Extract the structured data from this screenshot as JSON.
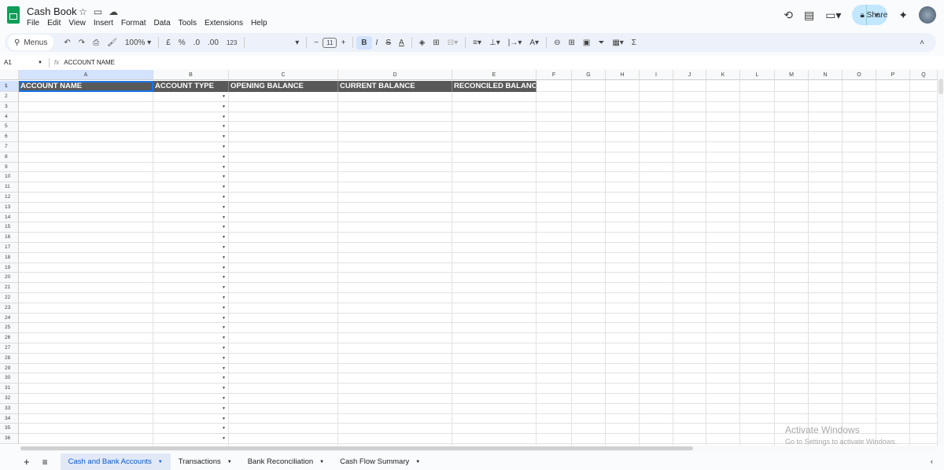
{
  "doc": {
    "title": "Cash Book"
  },
  "menu": [
    "File",
    "Edit",
    "View",
    "Insert",
    "Format",
    "Data",
    "Tools",
    "Extensions",
    "Help"
  ],
  "share": {
    "label": "Share"
  },
  "toolbar": {
    "search": "Menus",
    "zoom": "100%",
    "currency": "£",
    "percent": "%",
    "dec_dec": ".0",
    "inc_dec": ".00",
    "format_num": "123",
    "font_size": "11",
    "bold": "B",
    "italic": "I",
    "strike": "S",
    "text_color": "A",
    "sum": "Σ"
  },
  "formula_bar": {
    "cell": "A1",
    "fx": "fx",
    "content": "ACCOUNT NAME"
  },
  "columns": [
    "A",
    "B",
    "C",
    "D",
    "E",
    "F",
    "G",
    "H",
    "I",
    "J",
    "K",
    "L",
    "M",
    "N",
    "O",
    "P",
    "Q"
  ],
  "headers": [
    "ACCOUNT NAME",
    "ACCOUNT TYPE",
    "OPENING BALANCE",
    "CURRENT BALANCE",
    "RECONCILED BALANCE"
  ],
  "row_count": 36,
  "sheets": [
    {
      "label": "Cash and Bank Accounts",
      "active": true
    },
    {
      "label": "Transactions"
    },
    {
      "label": "Bank Reconciliation"
    },
    {
      "label": "Cash Flow Summary"
    }
  ],
  "watermark": {
    "title": "Activate Windows",
    "subtitle": "Go to Settings to activate Windows."
  }
}
